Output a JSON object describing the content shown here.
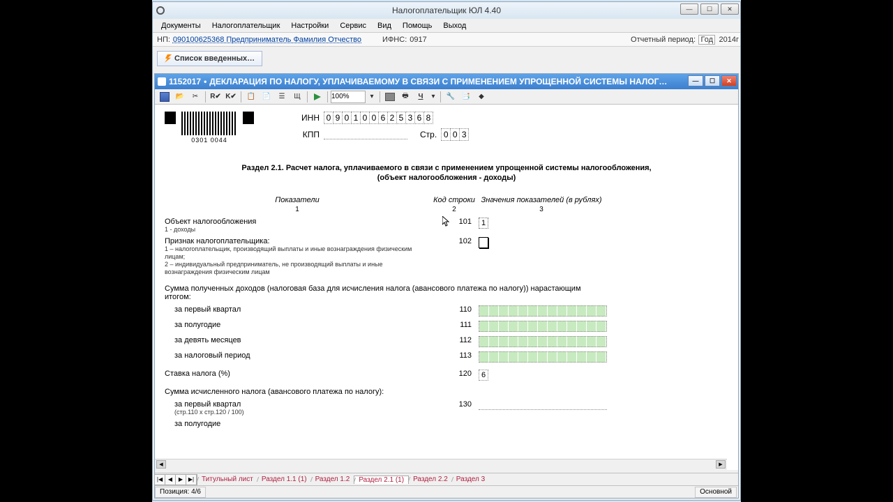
{
  "app": {
    "title": "Налогоплательщик ЮЛ 4.40"
  },
  "menu": {
    "documents": "Документы",
    "taxpayer": "Налогоплательщик",
    "settings": "Настройки",
    "service": "Сервис",
    "view": "Вид",
    "help": "Помощь",
    "exit": "Выход"
  },
  "infobar": {
    "np_label": "НП:",
    "np_value": "090100625368 Предприниматель Фамилия Отчество",
    "ifns_label": "ИФНС:",
    "ifns_value": "0917",
    "report_period": "Отчетный период:",
    "year_label": "Год",
    "year_value": "2014г"
  },
  "toolbar": {
    "spisok": "Список введенных…"
  },
  "inner": {
    "title_code": "1152017",
    "title_text": "ДЕКЛАРАЦИЯ ПО НАЛОГУ, УПЛАЧИВАЕМОМУ В СВЯЗИ С ПРИМЕНЕНИЕМ УПРОЩЕННОЙ СИСТЕМЫ НАЛОГ…",
    "zoom": "100%",
    "r_label": "R✔",
    "k_label": "K✔",
    "u_label": "Ч"
  },
  "doc": {
    "inn_label": "ИНН",
    "inn_chars": [
      "0",
      "9",
      "0",
      "1",
      "0",
      "0",
      "6",
      "2",
      "5",
      "3",
      "6",
      "8"
    ],
    "kpp_label": "КПП",
    "page_label": "Стр.",
    "page_chars": [
      "0",
      "0",
      "3"
    ],
    "barcode_text": "0301 0044",
    "section_title_1": "Раздел 2.1. Расчет налога, уплачиваемого в связи с применением упрощенной системы налогообложения,",
    "section_title_2": "(объект налогообложения - доходы)",
    "col_head_1": "Показатели",
    "col_head_2": "Код строки",
    "col_head_3": "Значения показателей (в рублях)",
    "col_n1": "1",
    "col_n2": "2",
    "col_n3": "3",
    "row_101_label": "Объект налогообложения",
    "row_101_sub": "1 - доходы",
    "row_101_code": "101",
    "row_101_val": "1",
    "row_102_label": "Признак налогоплательщика:",
    "row_102_sub1": "1 – налогоплательщик, производящий выплаты и иные вознаграждения физическим лицам;",
    "row_102_sub2": "2 – индивидуальный предприниматель, не производящий выплаты и иные вознаграждения физическим лицам",
    "row_102_code": "102",
    "row_sum_head": "Сумма полученных доходов (налоговая база для исчисления налога (авансового платежа по налогу)) нарастающим итогом:",
    "row_110_label": "за первый квартал",
    "row_110_code": "110",
    "row_111_label": "за полугодие",
    "row_111_code": "111",
    "row_112_label": "за девять месяцев",
    "row_112_code": "112",
    "row_113_label": "за налоговый период",
    "row_113_code": "113",
    "row_120_label": "Ставка налога (%)",
    "row_120_code": "120",
    "row_120_val": "6",
    "row_calc_head": "Сумма исчисленного налога (авансового платежа по налогу):",
    "row_130_label": "за первый квартал",
    "row_130_sub": "(стр.110 х стр.120 / 100)",
    "row_130_code": "130",
    "row_131_label": "за полугодие"
  },
  "tabs": {
    "title": "Титульный лист",
    "s11": "Раздел 1.1 (1)",
    "s12": "Раздел 1.2",
    "s21": "Раздел 2.1 (1)",
    "s22": "Раздел 2.2",
    "s3": "Раздел 3"
  },
  "status": {
    "position": "Позиция: 4/6",
    "mode": "Основной"
  }
}
